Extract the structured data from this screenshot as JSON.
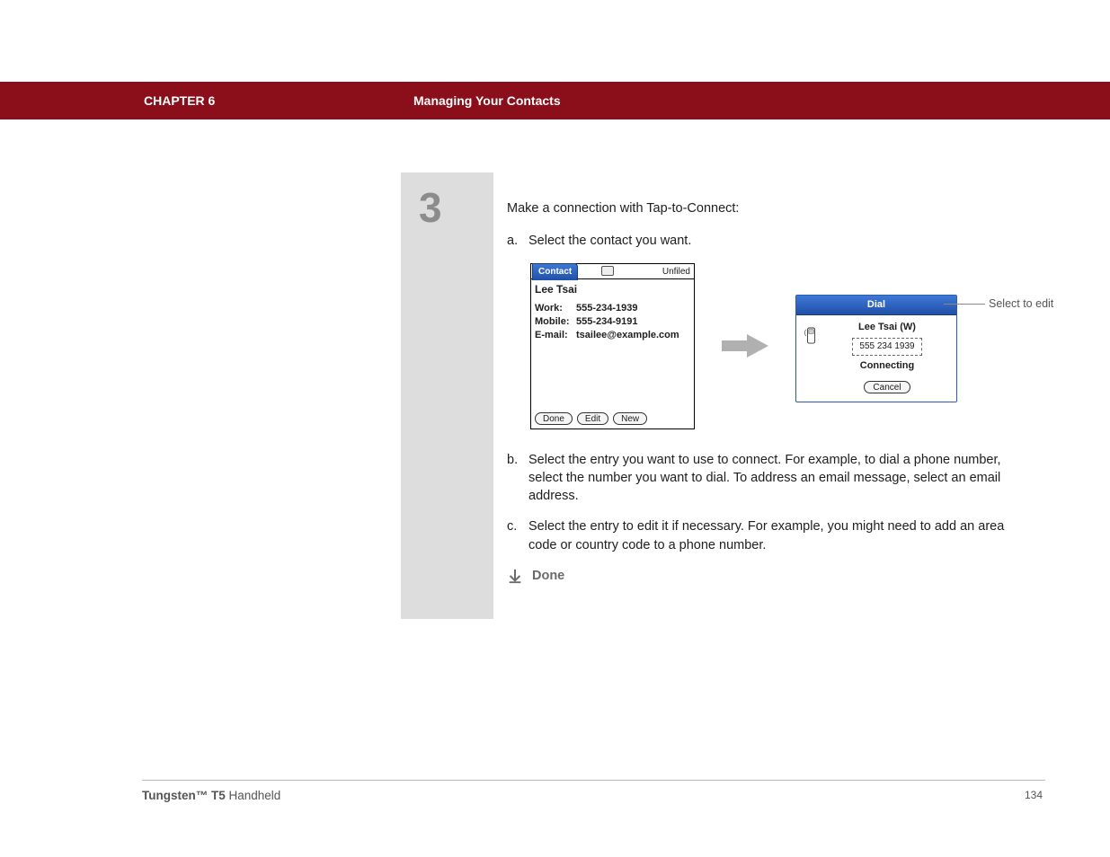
{
  "header": {
    "chapter": "CHAPTER 6",
    "title": "Managing Your Contacts"
  },
  "step_number": "3",
  "body": {
    "lead": "Make a connection with Tap-to-Connect:",
    "items": [
      {
        "letter": "a.",
        "text": "Select the contact you want."
      },
      {
        "letter": "b.",
        "text": "Select the entry you want to use to connect. For example, to dial a phone number, select the number you want to dial. To address an email message, select an email address."
      },
      {
        "letter": "c.",
        "text": "Select the entry to edit it if necessary. For example, you might need to add an area code or country code to a phone number."
      }
    ],
    "done": "Done"
  },
  "contact_screen": {
    "tab": "Contact",
    "category": "Unfiled",
    "name": "Lee Tsai",
    "rows": [
      {
        "label": "Work:",
        "value": "555-234-1939"
      },
      {
        "label": "Mobile:",
        "value": "555-234-9191"
      },
      {
        "label": "E-mail:",
        "value": "tsailee@example.com"
      }
    ],
    "buttons": [
      "Done",
      "Edit",
      "New"
    ]
  },
  "dial_screen": {
    "title": "Dial",
    "name": "Lee Tsai (W)",
    "number": "555 234 1939",
    "status": "Connecting",
    "cancel": "Cancel"
  },
  "annotation": "Select to edit",
  "footer": {
    "product_bold": "Tungsten™ T5",
    "product_rest": " Handheld",
    "page": "134"
  }
}
